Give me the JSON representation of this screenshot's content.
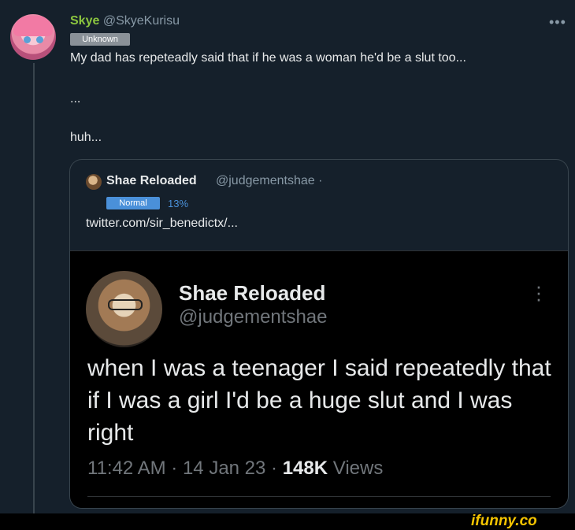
{
  "post": {
    "display_name": "Skye",
    "handle": "@SkyeKurisu",
    "badge": "Unknown",
    "text": "My dad has repeteadly said that if he was a woman he'd be a slut too...",
    "line2": "...",
    "line3": "huh...",
    "more_icon": "•••"
  },
  "quote": {
    "display_name": "Shae Reloaded",
    "handle": "@judgementshae ·",
    "badge": "Normal",
    "percent": "13%",
    "link": "twitter.com/sir_benedictx/..."
  },
  "embed": {
    "display_name": "Shae Reloaded",
    "handle": "@judgementshae",
    "text": "when I was a teenager I said repeatedly that if I was a girl I'd be a huge slut and I was right",
    "time": "11:42 AM · 14 Jan 23 · ",
    "views_count": "148K",
    "views_label": " Views"
  },
  "watermark": "ifunny.co",
  "colors": {
    "background": "#15202b",
    "name_green": "#8cc63f",
    "badge_blue": "#4a90d9",
    "watermark_yellow": "#f5c400"
  }
}
